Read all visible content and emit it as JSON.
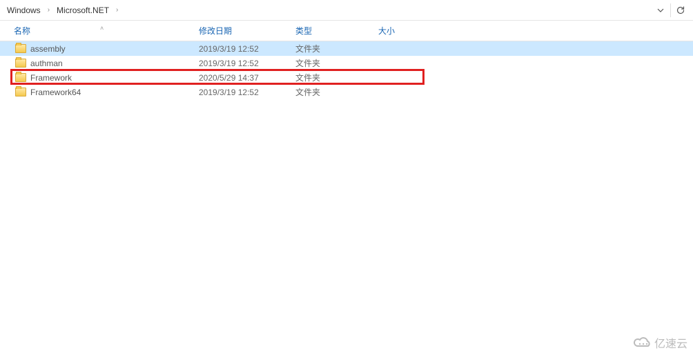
{
  "breadcrumb": {
    "items": [
      "Windows",
      "Microsoft.NET"
    ]
  },
  "columns": {
    "name": "名称",
    "date": "修改日期",
    "type": "类型",
    "size": "大小"
  },
  "rows": [
    {
      "name": "assembly",
      "date": "2019/3/19 12:52",
      "type": "文件夹",
      "size": "",
      "selected": true,
      "highlighted": false
    },
    {
      "name": "authman",
      "date": "2019/3/19 12:52",
      "type": "文件夹",
      "size": "",
      "selected": false,
      "highlighted": false
    },
    {
      "name": "Framework",
      "date": "2020/5/29 14:37",
      "type": "文件夹",
      "size": "",
      "selected": false,
      "highlighted": true
    },
    {
      "name": "Framework64",
      "date": "2019/3/19 12:52",
      "type": "文件夹",
      "size": "",
      "selected": false,
      "highlighted": false
    }
  ],
  "watermark": "亿速云"
}
